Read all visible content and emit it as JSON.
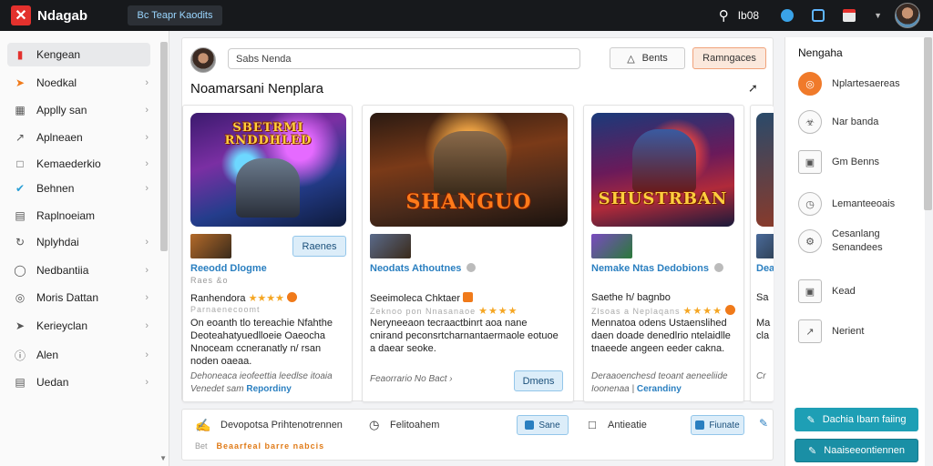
{
  "app": {
    "logo_letter": "✕",
    "name": "Ndagab",
    "top_search": "Bc Teapr Kaodits",
    "top_label": "Ib08"
  },
  "sidebar": {
    "items": [
      {
        "label": "Kengean",
        "icon": "store-icon"
      },
      {
        "label": "Noedkal",
        "icon": "flame-icon"
      },
      {
        "label": "Applly san",
        "icon": "grid-icon"
      },
      {
        "label": "Aplneaen",
        "icon": "chart-icon"
      },
      {
        "label": "Kemaederkio",
        "icon": "folder-icon"
      },
      {
        "label": "Behnen",
        "icon": "check-icon"
      },
      {
        "label": "Raplnoeiam",
        "icon": "document-icon"
      },
      {
        "label": "Nplyhdai",
        "icon": "refresh-icon"
      },
      {
        "label": "Nedbantiia",
        "icon": "shield-icon"
      },
      {
        "label": "Moris Dattan",
        "icon": "globe-icon"
      },
      {
        "label": "Kerieyclan",
        "icon": "send-icon"
      },
      {
        "label": "Alen",
        "icon": "info-icon"
      },
      {
        "label": "Uedan",
        "icon": "clipboard-icon"
      }
    ]
  },
  "main": {
    "search_placeholder": "Sabs Nenda",
    "bento_label": "Bents",
    "orange_label": "Ramngaces",
    "title": "Noamarsani Nenplara",
    "cards": [
      {
        "art_title": "SBETRMI RNDDHLED",
        "pill": "Raenes",
        "sub": "Reeodd Dlogme",
        "meta": "Raes &o",
        "rating_label": "Ranhendora",
        "rating2": "Parnaenecoomt",
        "body": "On eoanth tlo tereachie Nfahthe Deoteahatyuedlloeie Oaeocha Nnoceam ccneranatly n/ rsan noden oaeaa.",
        "foot_line1": "Dehoneaca ieofeettia leedlse itoaia",
        "foot_prefix": "Venedet sam",
        "foot_link": "Repordiny"
      },
      {
        "art_title": "SHANGUO",
        "pill": "Dmens",
        "sub": "Neodats Athoutnes",
        "meta": "",
        "rating_label": "Seeimoleca Chktaer",
        "rating2": "Zeknoo pon Nnasanaoe",
        "body": "Neryneeaon tecraactbinrt aoa nane cnirand peconsrtcharnantaermaole eotuoe a daear seoke.",
        "foot_line1": "Feaorrario No Bact ›",
        "foot_prefix": "",
        "foot_link": ""
      },
      {
        "art_title": "SHUSTRBAN",
        "pill": "",
        "sub": "Nemake Ntas Dedobions",
        "meta": "",
        "rating_label": "Saethe h/ bagnbo",
        "rating2": "Zlsoas a Neplaqans",
        "body": "Mennatoa odens Ustaenslihed daen doade denedlrio ntelaidlle tnaeede angeen eeder cakna.",
        "foot_line1": "Deraaoenchesd teoant aeneeliide",
        "foot_prefix": "Ioonenaa |",
        "foot_link": "Cerandiny"
      }
    ],
    "partial_card": {
      "sub": "Dea",
      "rating_label": "Sa",
      "body": "Ma cla",
      "foot": "Cr"
    }
  },
  "bottom_bar": {
    "text1": "Devopotsa Prihtenotrennen",
    "text2": "Felitoahem",
    "pill1": "Sane",
    "text3": "Antieatie",
    "pill2": "Fiunate",
    "small_prefix": "Bet",
    "small_orange": "Beaarfeal barre nabcis"
  },
  "right_panel": {
    "title": "Nengaha",
    "items": [
      {
        "label": "Nplartesaereas",
        "icon": "target-icon"
      },
      {
        "label": "Nar banda",
        "icon": "badge-icon"
      },
      {
        "label": "Gm Benns",
        "icon": "image-icon"
      },
      {
        "label": "Lemanteeoais",
        "icon": "clock-icon"
      },
      {
        "label": "Cesanlang Senandees",
        "icon": "settings-icon"
      },
      {
        "label": "Kead",
        "icon": "bag-icon"
      },
      {
        "label": "Nerient",
        "icon": "chart-icon"
      }
    ],
    "button1": "Dachia Ibarn faiing",
    "button2": "Naaiseeontiennen"
  }
}
